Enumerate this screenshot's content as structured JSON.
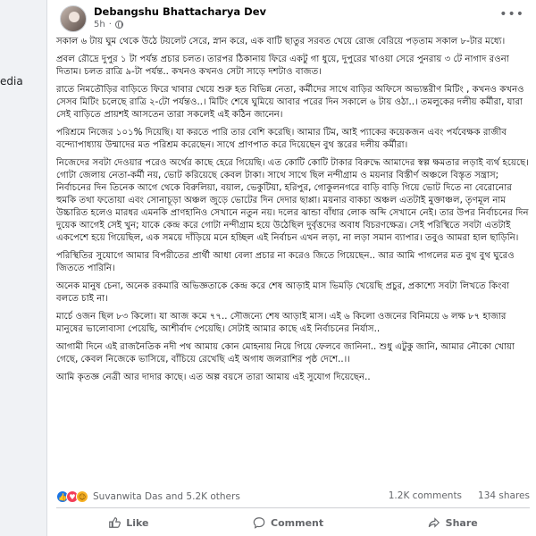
{
  "left_strip": {
    "text": "edia"
  },
  "post": {
    "author": "Debangshu Bhattacharya Dev",
    "time": "5h",
    "more_label": "•••",
    "paragraphs": [
      "সকাল ৬ টায় ঘুম থেকে উঠে টয়লেট সেরে, স্নান করে, এক বাটি ছাতুর সরবত খেয়ে রোজ বেরিয়ে পড়তাম সকাল ৮-টার মধ্যে।",
      "প্রবল রৌদ্রে দুপুর ১ টা পর্যন্ত প্রচার চলত। তারপর ঠিকানায় ফিরে একটু গা ধুয়ে, দুপুরের খাওয়া সেরে পুনরায় ৩ টে নাগাদ রওনা দিতাম। চলত রাত্রি ৯-টা পর্যন্ত.. কখনও কখনও সেটা সাড়ে দশটাও বাজত।",
      "রাতে নিমতৌড়ির বাড়িতে ফিরে খাবার খেয়ে শুরু হত বিভিন্ন নেতা, কর্মীদের সাথে বাড়ির অফিসে অভ্যন্তরীণ মিটিং , কখনও কখনও সেসব মিটিং চলেছে রাত্রি ২-টো পর্যন্তও..। মিটিং শেষে ঘুমিয়ে আবার পরের দিন সকালে ৬ টায় ওঠা..। তমলুকের দলীয় কর্মীরা, যারা সেই বাড়িতে প্রায়শই আসতেন তারা সকলেই এই কঠিন জানেন।",
      "পরিশ্রমে নিজের ১০১% দিয়েছি। যা করতে পারি তার বেশি করেছি। আমার টিম, আই প্যাকের কয়েকজন এবং পর্যবেক্ষক রাজীব বন্দ্যোপাধ্যায় উন্মাদের মত পরিশ্রম করেছেন। সাথে প্রাণপাত করে দিয়েছেন বুথ স্তরের দলীয় কর্মীরা।",
      "নিজেদের সবটা দেওয়ার পরেও অর্থের কাছে হেরে গিয়েছি। এত কোটি কোটি টাকার বিরুদ্ধে আমাদের স্বল্প ক্ষমতার লড়াই ব্যর্থ হয়েছে। গোটা জেলায় নেতা-কর্মী নয়, ভোট করিয়েছে কেবল টাকা। সাথে সাথে ছিল নন্দীগ্রাম ও ময়নার বিস্তীর্ণ অঞ্চলে বিস্তৃত সন্ত্রাস; নির্বাচনের দিন তিনেক আগে থেকে বিরুলিয়া, বয়াল, ভেকুটিয়া, হরিপুর, গোকুলনগরে বাড়ি বাড়ি গিয়ে ভোট দিতে না বেরোনোর হুমকি তথা ফতোয়া এবং সোনাচূড়া অঞ্চল জুড়ে ভোটের দিন দেদার ছাপ্পা। ময়নার বাকচা অঞ্চল এতটাই মুক্তাঞ্চল, তৃণমূল নাম উচ্চারিত হলেও মারধর এমনকি প্রাণহানিও সেখানে নতুন নয়। দলের ঝান্ডা বাঁধার লোক অব্দি সেখানে নেই। তার উপর নির্বাচনের দিন দুয়েক আগেই সেই খুন; যাকে কেন্দ্র করে গোটা নন্দীগ্রাম হয়ে উঠেছিল দুর্বৃত্তদের অবাধ বিচরণক্ষেত্র। সেই পরিস্থিতে সবটা এতটাই একপেশে হয়ে গিয়েছিল, এক সময়ে দাঁড়িয়ে মনে হচ্ছিল এই নির্বাচন এখন লড়া, না লড়া সমান ব্যাপার। তবুও আমরা হাল ছাড়িনি।",
      "পরিস্থিতির সুযোগে আমার বিপরীতের প্রার্থী আধা বেলা প্রচার না করেও জিতে গিয়েছেন.. আর আমি পাগলের মত বুথ বুথ ঘুরেও জিততে পারিনি।",
      "অনেক মানুষ চেনা, অনেক রকমারি অভিজ্ঞতাকে কেন্দ্র করে শেষ আড়াই মাস ভিমড়ি খেয়েছি প্রচুর, প্রকাশ্যে সবটা লিখতে কিংবা বলতে চাই না।",
      "মার্চে ওজন ছিল ৮৩ কিলো। যা আজ কমে ৭৭.. সৌজন্যে শেষ আড়াই মাস। এই ৬ কিলো ওজনের বিনিময়ে ৬ লক্ষ ৮৭ হাজার মানুষের ভালোবাসা পেয়েছি, আশীর্বাদ পেয়েছি। সেটাই আমার কাছে এই নির্বাচনের নির্যাস..",
      "আগামী দিনে এই রাজনৈতিক নদী পথ আমায় কোন মোহনায় নিয়ে গিয়ে ফেলবে জানিনা.. শুধু এটুকু জানি, আমার নৌকো খোয়া গেছে, কেবল নিজেকে ভাসিয়ে, বাঁচিয়ে রেখেছি এই অগাধ জলরাশির পৃষ্ঠ দেশে..।।",
      "আমি কৃতজ্ঞ নেত্রী আর দাদার কাছে। এত অল্প বয়সে তারা আমায় এই সুযোগ দিয়েছেন.."
    ],
    "reactions": {
      "icons": [
        "like-icon",
        "love-icon",
        "care-icon"
      ],
      "names": "Suvanwita Das and 5.2K others",
      "comments": "1.2K comments",
      "shares": "134 shares"
    },
    "actions": {
      "like": "Like",
      "comment": "Comment",
      "share": "Share"
    }
  }
}
